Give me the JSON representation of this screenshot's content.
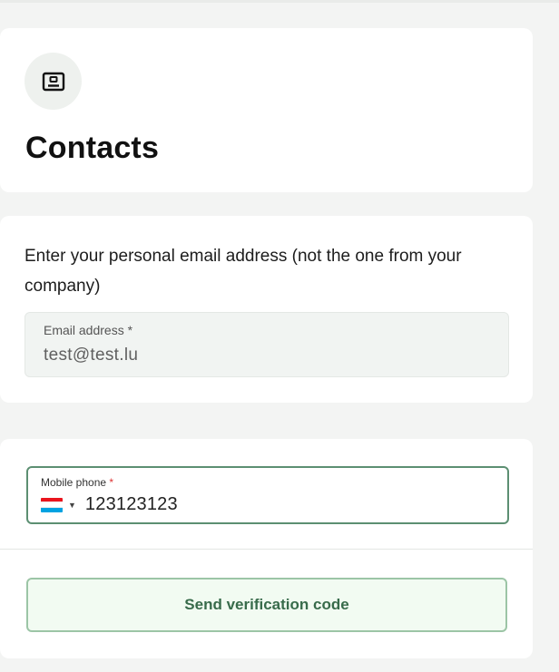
{
  "header": {
    "icon": "id-card-icon",
    "title": "Contacts"
  },
  "email_section": {
    "instruction": "Enter your personal email address (not the one from your company)",
    "email_field": {
      "label": "Email address *",
      "value": "test@test.lu"
    }
  },
  "phone_section": {
    "phone_field": {
      "label": "Mobile phone",
      "required_mark": "*",
      "country_flag": "luxembourg-flag-icon",
      "value": "123123123"
    },
    "send_button_label": "Send verification code"
  },
  "colors": {
    "accent_border": "#5c8f72",
    "button_text": "#386b4b",
    "button_bg": "#f2fbf2",
    "required": "#dd3333"
  }
}
